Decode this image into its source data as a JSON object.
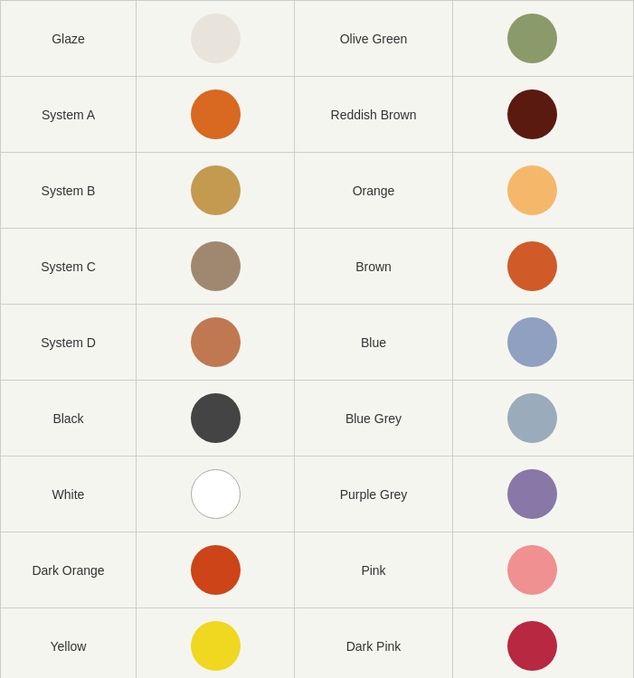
{
  "rows": [
    {
      "left_label": "Glaze",
      "left_color": "#e8e4dc",
      "left_outline": false,
      "right_label": "Olive Green",
      "right_color": "#8a9a6a"
    },
    {
      "left_label": "System A",
      "left_color": "#d96820",
      "left_outline": false,
      "right_label": "Reddish Brown",
      "right_color": "#5a1a10"
    },
    {
      "left_label": "System B",
      "left_color": "#c49a50",
      "left_outline": false,
      "right_label": "Orange",
      "right_color": "#f5b86a"
    },
    {
      "left_label": "System C",
      "left_color": "#a08870",
      "left_outline": false,
      "right_label": "Brown",
      "right_color": "#d05a28"
    },
    {
      "left_label": "System D",
      "left_color": "#c07850",
      "left_outline": false,
      "right_label": "Blue",
      "right_color": "#8fa0c0"
    },
    {
      "left_label": "Black",
      "left_color": "#444444",
      "left_outline": false,
      "right_label": "Blue Grey",
      "right_color": "#9aabbc"
    },
    {
      "left_label": "White",
      "left_color": "#ffffff",
      "left_outline": true,
      "right_label": "Purple Grey",
      "right_color": "#8878a8"
    },
    {
      "left_label": "Dark Orange",
      "left_color": "#cc4418",
      "left_outline": false,
      "right_label": "Pink",
      "right_color": "#f09090"
    },
    {
      "left_label": "Yellow",
      "left_color": "#f0d820",
      "left_outline": false,
      "right_label": "Dark Pink",
      "right_color": "#b82840"
    }
  ]
}
